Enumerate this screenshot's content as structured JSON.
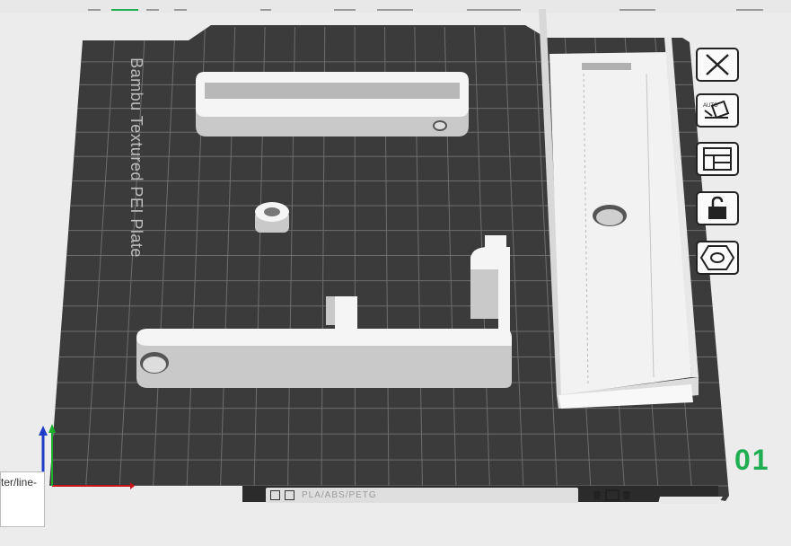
{
  "plate": {
    "label": "Bambu Textured PEI Plate",
    "number": "01"
  },
  "side_toolbar": [
    {
      "name": "close-plate-button",
      "icon": "close-x-icon"
    },
    {
      "name": "auto-orient-button",
      "icon": "auto-orient-icon",
      "badge": "AUTO"
    },
    {
      "name": "arrange-button",
      "icon": "arrange-layout-icon"
    },
    {
      "name": "lock-plate-button",
      "icon": "unlock-icon"
    },
    {
      "name": "plate-settings-button",
      "icon": "hexagon-nut-icon"
    }
  ],
  "info_bar": {
    "filament": "PLA/ABS/PETG"
  },
  "tooltip": {
    "text": "ter/line-"
  },
  "colors": {
    "plate": "#3b3b3b",
    "grid": "#6e6e6e",
    "part": "#f2f2f2",
    "part_shadow": "#c9c9c9",
    "plate_number": "#1fae52"
  }
}
